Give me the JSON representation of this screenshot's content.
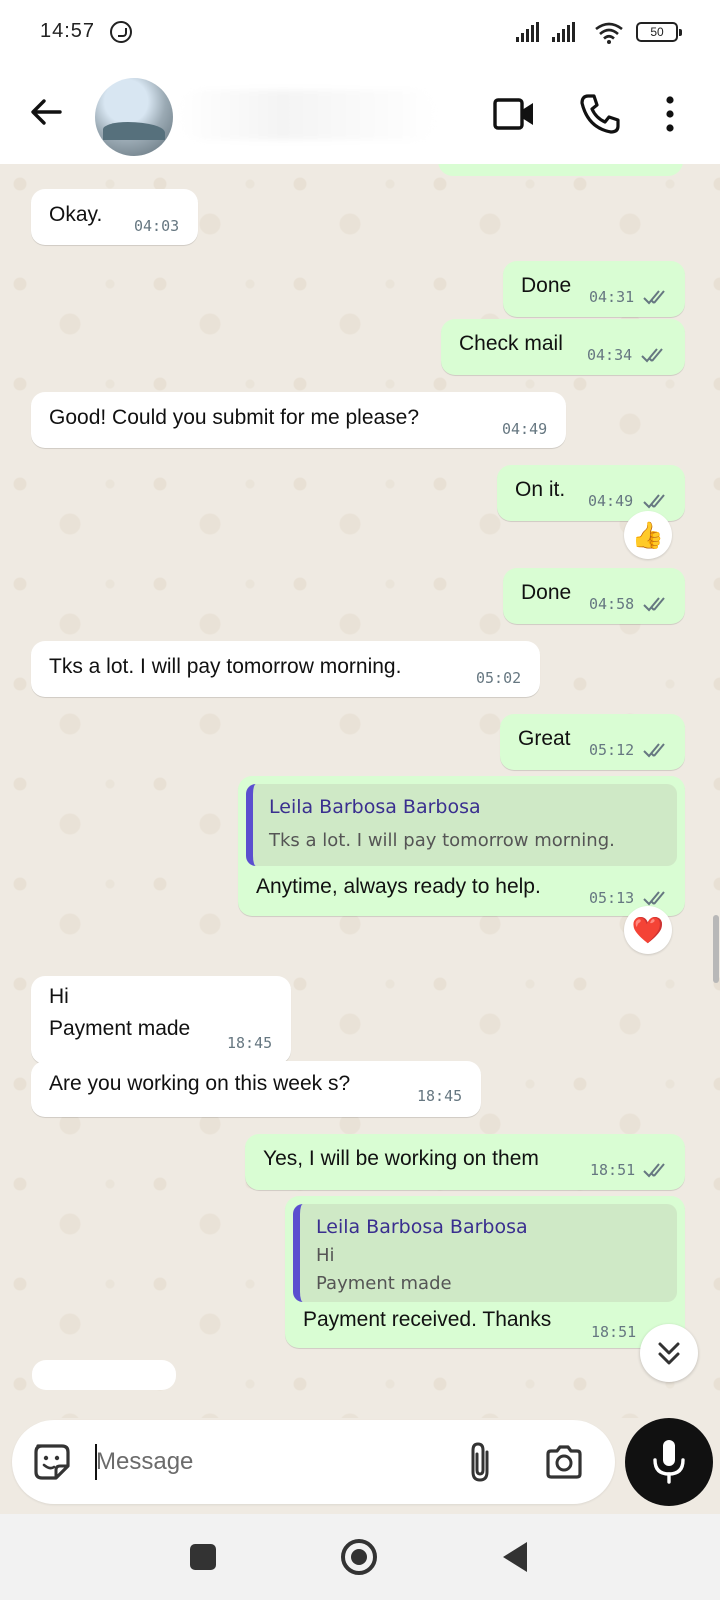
{
  "status_bar": {
    "time": "14:57",
    "battery": "50",
    "icons": [
      "whatsapp-icon",
      "signal-icon",
      "signal-icon",
      "wifi-icon",
      "battery-icon"
    ]
  },
  "header": {
    "icons": [
      "back-arrow-icon",
      "video-call-icon",
      "phone-call-icon",
      "more-options-icon"
    ]
  },
  "messages": [
    {
      "dir": "in",
      "text": "Okay.",
      "time": "04:03"
    },
    {
      "dir": "out",
      "text": "Done",
      "time": "04:31",
      "status": "read"
    },
    {
      "dir": "out",
      "text": "Check mail",
      "time": "04:34",
      "status": "read"
    },
    {
      "dir": "in",
      "text": "Good! Could you submit for me please?",
      "time": "04:49"
    },
    {
      "dir": "out",
      "text": "On it.",
      "time": "04:49",
      "status": "read",
      "reaction": "👍"
    },
    {
      "dir": "out",
      "text": "Done",
      "time": "04:58",
      "status": "read"
    },
    {
      "dir": "in",
      "text": "Tks a lot. I will pay tomorrow morning.",
      "time": "05:02"
    },
    {
      "dir": "out",
      "text": "Great",
      "time": "05:12",
      "status": "read"
    },
    {
      "dir": "out",
      "quote": {
        "name": "Leila Barbosa Barbosa",
        "lines": [
          "Tks a lot. I will pay tomorrow morning."
        ]
      },
      "text": "Anytime, always ready to help.",
      "time": "05:13",
      "status": "read",
      "reaction": "❤️"
    },
    {
      "dir": "in",
      "lines": [
        "Hi",
        "Payment made"
      ],
      "time": "18:45"
    },
    {
      "dir": "in",
      "text": "Are you working on this week s?",
      "time": "18:45"
    },
    {
      "dir": "out",
      "text": "Yes, I will be working on them",
      "time": "18:51",
      "status": "read"
    },
    {
      "dir": "out",
      "quote": {
        "name": "Leila Barbosa Barbosa",
        "lines": [
          "Hi",
          "Payment made"
        ]
      },
      "text": "Payment received. Thanks",
      "time": "18:51",
      "status": "read"
    }
  ],
  "composer": {
    "placeholder": "Message",
    "icons": [
      "sticker-icon",
      "attach-icon",
      "camera-icon",
      "mic-icon"
    ]
  },
  "colors": {
    "incoming_bubble": "#ffffff",
    "outgoing_bubble": "#d9fdd3",
    "chat_background": "#efeae2",
    "quote_bar": "#5b4fcf",
    "read_ticks": "#667781"
  }
}
